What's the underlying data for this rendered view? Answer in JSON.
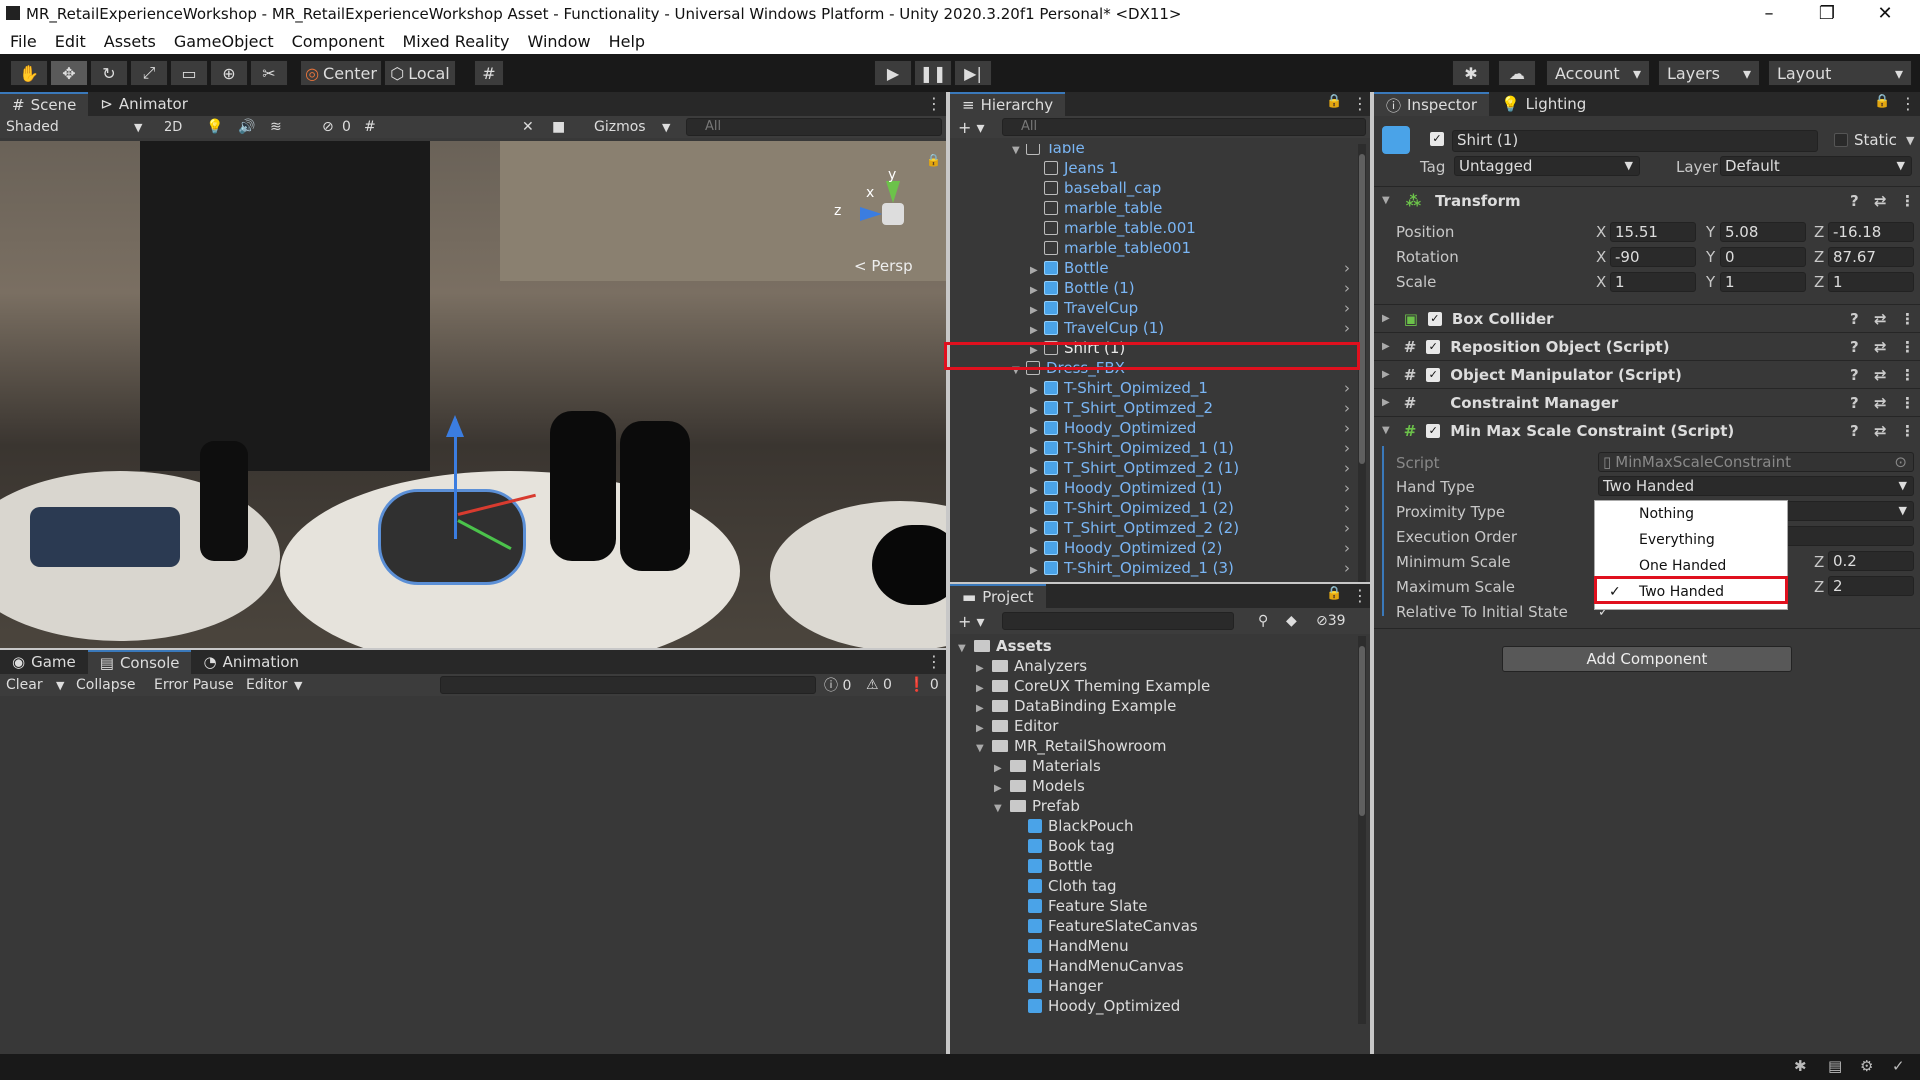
{
  "window": {
    "title": "MR_RetailExperienceWorkshop - MR_RetailExperienceWorkshop Asset - Functionality - Universal Windows Platform - Unity 2020.3.20f1 Personal* <DX11>"
  },
  "menu": [
    "File",
    "Edit",
    "Assets",
    "GameObject",
    "Component",
    "Mixed Reality",
    "Window",
    "Help"
  ],
  "toolbar": {
    "center": "Center",
    "local": "Local",
    "account": "Account",
    "layers": "Layers",
    "layout": "Layout"
  },
  "scene": {
    "tab_scene": "Scene",
    "tab_animator": "Animator",
    "shading": "Shaded",
    "mode2d": "2D",
    "hidden_count": "0",
    "gizmos": "Gizmos",
    "search_placeholder": "All",
    "persp": "Persp",
    "axis_y": "y",
    "axis_x": "x",
    "axis_z": "z"
  },
  "hierarchy": {
    "tab": "Hierarchy",
    "search_placeholder": "All",
    "rows": [
      {
        "label": "Table",
        "indent": 3,
        "arrow": "▼",
        "blue": false,
        "chev": false
      },
      {
        "label": "Jeans 1",
        "indent": 4,
        "arrow": "",
        "blue": false,
        "chev": false
      },
      {
        "label": "baseball_cap",
        "indent": 4,
        "arrow": "",
        "blue": false,
        "chev": false
      },
      {
        "label": "marble_table",
        "indent": 4,
        "arrow": "",
        "blue": false,
        "chev": false
      },
      {
        "label": "marble_table.001",
        "indent": 4,
        "arrow": "",
        "blue": false,
        "chev": false
      },
      {
        "label": "marble_table001",
        "indent": 4,
        "arrow": "",
        "blue": false,
        "chev": false
      },
      {
        "label": "Bottle",
        "indent": 4,
        "arrow": "▶",
        "blue": true,
        "chev": true
      },
      {
        "label": "Bottle (1)",
        "indent": 4,
        "arrow": "▶",
        "blue": true,
        "chev": true
      },
      {
        "label": "TravelCup",
        "indent": 4,
        "arrow": "▶",
        "blue": true,
        "chev": true
      },
      {
        "label": "TravelCup (1)",
        "indent": 4,
        "arrow": "▶",
        "blue": true,
        "chev": true
      },
      {
        "label": "Shirt (1)",
        "indent": 4,
        "arrow": "▶",
        "blue": false,
        "chev": false,
        "white": true
      },
      {
        "label": "Dress_FBX",
        "indent": 3,
        "arrow": "▼",
        "blue": false,
        "chev": false
      },
      {
        "label": "T-Shirt_Opimized_1",
        "indent": 4,
        "arrow": "▶",
        "blue": true,
        "chev": true
      },
      {
        "label": "T_Shirt_Optimzed_2",
        "indent": 4,
        "arrow": "▶",
        "blue": true,
        "chev": true
      },
      {
        "label": "Hoody_Optimized",
        "indent": 4,
        "arrow": "▶",
        "blue": true,
        "chev": true
      },
      {
        "label": "T-Shirt_Opimized_1 (1)",
        "indent": 4,
        "arrow": "▶",
        "blue": true,
        "chev": true
      },
      {
        "label": "T_Shirt_Optimzed_2 (1)",
        "indent": 4,
        "arrow": "▶",
        "blue": true,
        "chev": true
      },
      {
        "label": "Hoody_Optimized (1)",
        "indent": 4,
        "arrow": "▶",
        "blue": true,
        "chev": true
      },
      {
        "label": "T-Shirt_Opimized_1 (2)",
        "indent": 4,
        "arrow": "▶",
        "blue": true,
        "chev": true
      },
      {
        "label": "T_Shirt_Optimzed_2 (2)",
        "indent": 4,
        "arrow": "▶",
        "blue": true,
        "chev": true
      },
      {
        "label": "Hoody_Optimized (2)",
        "indent": 4,
        "arrow": "▶",
        "blue": true,
        "chev": true
      },
      {
        "label": "T-Shirt_Opimized_1 (3)",
        "indent": 4,
        "arrow": "▶",
        "blue": true,
        "chev": true
      }
    ]
  },
  "project": {
    "tab": "Project",
    "hidden_count": "39",
    "rows": [
      {
        "label": "Assets",
        "indent": 0,
        "arrow": "▼",
        "kind": "folder",
        "bold": true
      },
      {
        "label": "Analyzers",
        "indent": 1,
        "arrow": "▶",
        "kind": "folder"
      },
      {
        "label": "CoreUX Theming Example",
        "indent": 1,
        "arrow": "▶",
        "kind": "folder"
      },
      {
        "label": "DataBinding Example",
        "indent": 1,
        "arrow": "▶",
        "kind": "folder"
      },
      {
        "label": "Editor",
        "indent": 1,
        "arrow": "▶",
        "kind": "folder"
      },
      {
        "label": "MR_RetailShowroom",
        "indent": 1,
        "arrow": "▼",
        "kind": "folder"
      },
      {
        "label": "Materials",
        "indent": 2,
        "arrow": "▶",
        "kind": "folder"
      },
      {
        "label": "Models",
        "indent": 2,
        "arrow": "▶",
        "kind": "folder"
      },
      {
        "label": "Prefab",
        "indent": 2,
        "arrow": "▼",
        "kind": "folder"
      },
      {
        "label": "BlackPouch",
        "indent": 3,
        "arrow": "",
        "kind": "prefab"
      },
      {
        "label": "Book tag",
        "indent": 3,
        "arrow": "",
        "kind": "prefab"
      },
      {
        "label": "Bottle",
        "indent": 3,
        "arrow": "",
        "kind": "prefab"
      },
      {
        "label": "Cloth tag",
        "indent": 3,
        "arrow": "",
        "kind": "prefab"
      },
      {
        "label": "Feature Slate",
        "indent": 3,
        "arrow": "",
        "kind": "prefab"
      },
      {
        "label": "FeatureSlateCanvas",
        "indent": 3,
        "arrow": "",
        "kind": "prefab"
      },
      {
        "label": "HandMenu",
        "indent": 3,
        "arrow": "",
        "kind": "prefab"
      },
      {
        "label": "HandMenuCanvas",
        "indent": 3,
        "arrow": "",
        "kind": "prefab"
      },
      {
        "label": "Hanger",
        "indent": 3,
        "arrow": "",
        "kind": "prefab"
      },
      {
        "label": "Hoody_Optimized",
        "indent": 3,
        "arrow": "",
        "kind": "prefab"
      }
    ]
  },
  "console": {
    "tab_game": "Game",
    "tab_console": "Console",
    "tab_animation": "Animation",
    "clear": "Clear",
    "collapse": "Collapse",
    "error_pause": "Error Pause",
    "editor": "Editor",
    "count_log": "0",
    "count_warn": "0",
    "count_err": "0"
  },
  "inspector": {
    "tab_inspector": "Inspector",
    "tab_lighting": "Lighting",
    "object_name": "Shirt (1)",
    "static": "Static",
    "tag_label": "Tag",
    "tag_value": "Untagged",
    "layer_label": "Layer",
    "layer_value": "Default",
    "transform": {
      "title": "Transform",
      "position": {
        "label": "Position",
        "x": "15.51",
        "y": "5.08",
        "z": "-16.18"
      },
      "rotation": {
        "label": "Rotation",
        "x": "-90",
        "y": "0",
        "z": "87.67"
      },
      "scale": {
        "label": "Scale",
        "x": "1",
        "y": "1",
        "z": "1"
      }
    },
    "components": [
      "Box Collider",
      "Reposition Object (Script)",
      "Object Manipulator (Script)",
      "Constraint Manager",
      "Min Max Scale Constraint (Script)"
    ],
    "script_label": "Script",
    "script_value": "MinMaxScaleConstraint",
    "hand_type_label": "Hand Type",
    "hand_type_value": "Two Handed",
    "proximity_label": "Proximity Type",
    "execution_label": "Execution Order",
    "min_scale_label": "Minimum Scale",
    "min_z": "0.2",
    "max_scale_label": "Maximum Scale",
    "max_z": "2",
    "relative_label": "Relative To Initial State",
    "add_component": "Add Component",
    "dropdown": [
      {
        "label": "Nothing",
        "checked": false
      },
      {
        "label": "Everything",
        "checked": false
      },
      {
        "label": "One Handed",
        "checked": false
      },
      {
        "label": "Two Handed",
        "checked": true
      }
    ]
  }
}
